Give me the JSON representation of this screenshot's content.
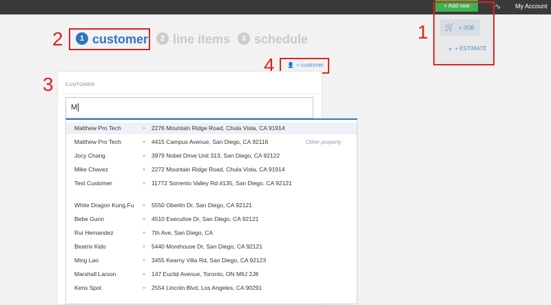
{
  "topbar": {
    "add_new_label": "+ Add new",
    "account_label": "My Account",
    "activity_icon": "pulse-icon"
  },
  "add_new_menu": {
    "job_label": "+ JOB",
    "estimate_label": "+ ESTIMATE"
  },
  "annotations": [
    "1",
    "2",
    "3",
    "4"
  ],
  "annotation_color": "#e02020",
  "steps": [
    {
      "number": "1",
      "label": "customer"
    },
    {
      "number": "2",
      "label": "line items"
    },
    {
      "number": "3",
      "label": "schedule"
    }
  ],
  "add_customer_label": "+ customer",
  "customer": {
    "section_label": "CUSTOMER",
    "search_value": "M"
  },
  "results": [
    {
      "name": "Matthew Pro Tech",
      "address": "2276 Mountain Ridge Road, Chula Vista, CA 91914",
      "tag": ""
    },
    {
      "name": "Matthew Pro Tech",
      "address": "4415 Campus Avenue, San Diego, CA 92116",
      "tag": "Other property"
    },
    {
      "name": "Jocy Chang",
      "address": "3979 Nobel Drive Unit 313, San Diego, CA 92122",
      "tag": ""
    },
    {
      "name": "Mike Chavez",
      "address": "2272 Mountain Ridge Road, Chula Vista, CA 91914",
      "tag": ""
    },
    {
      "name": "Test Customer",
      "address": "11772 Sorrento Valley Rd #135, San Diego, CA 92121",
      "tag": ""
    },
    {
      "name": "White Dragon Kung Fu",
      "address": "5550 Oberlin Dr, San Diego, CA 92121",
      "tag": ""
    },
    {
      "name": "Bebe Gunn",
      "address": "4510 Executive Dr, San Diego, CA 92121",
      "tag": ""
    },
    {
      "name": "Rui Hernandez",
      "address": "7th Ave, San Diego, CA",
      "tag": ""
    },
    {
      "name": "Beatrix Kido",
      "address": "5440 Morehouse Dr, San Diego, CA 92121",
      "tag": ""
    },
    {
      "name": "Ming Lao",
      "address": "3455 Kearny Villa Rd, San Diego, CA 92123",
      "tag": ""
    },
    {
      "name": "Marshall Larson",
      "address": "147 Euclid Avenue, Toronto, ON M6J 2J8",
      "tag": ""
    },
    {
      "name": "Kens Spot",
      "address": "2554 Lincoln Blvd, Los Angeles, CA 90291",
      "tag": ""
    }
  ],
  "colors": {
    "accent": "#2e74c5",
    "add_new_green": "#3fb34f",
    "topbar": "#3a3a3a"
  }
}
